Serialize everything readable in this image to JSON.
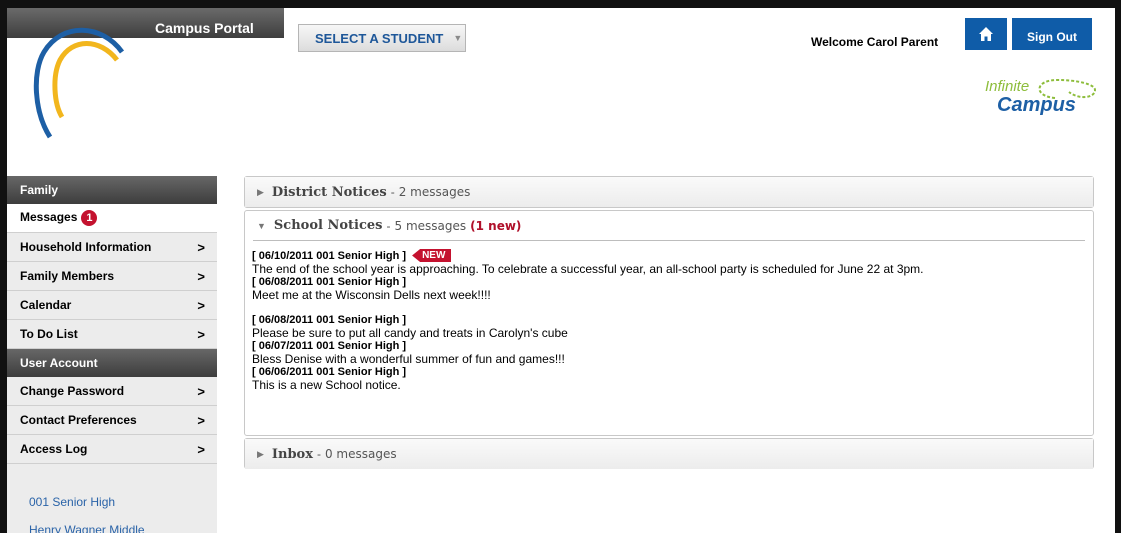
{
  "header": {
    "portal_title": "Campus Portal",
    "select_student_label": "SELECT A STUDENT",
    "welcome_text": "Welcome Carol Parent",
    "home_icon": "home-icon",
    "sign_out_label": "Sign Out",
    "logo_line1": "Infinite",
    "logo_line2": "Campus"
  },
  "sidebar": {
    "sections": [
      {
        "title": "Family",
        "items": [
          {
            "label": "Messages",
            "badge": "1"
          },
          {
            "label": "Household Information",
            "chevron": ">"
          },
          {
            "label": "Family Members",
            "chevron": ">"
          },
          {
            "label": "Calendar",
            "chevron": ">"
          },
          {
            "label": "To Do List",
            "chevron": ">"
          }
        ]
      },
      {
        "title": "User Account",
        "items": [
          {
            "label": "Change Password",
            "chevron": ">"
          },
          {
            "label": "Contact Preferences",
            "chevron": ">"
          },
          {
            "label": "Access Log",
            "chevron": ">"
          }
        ]
      }
    ],
    "schools": [
      "001 Senior High",
      "Henry Wagner Middle"
    ]
  },
  "panels": {
    "district": {
      "title": "District Notices",
      "sep": "-",
      "count": "2 messages"
    },
    "school": {
      "title": "School Notices",
      "sep": "-",
      "count": "5 messages",
      "new_count": "(1 new)",
      "new_tag": "NEW",
      "messages": [
        {
          "header": "[ 06/10/2011 001 Senior High ]",
          "text": "The end of the school year is approaching. To celebrate a successful year, an all-school party is scheduled for June 22 at 3pm."
        },
        {
          "header": "[ 06/08/2011 001 Senior High ]",
          "text": "Meet me at the Wisconsin Dells next week!!!!"
        },
        {
          "header": "[ 06/08/2011 001 Senior High ]",
          "text": "Please be sure to put all candy and treats in Carolyn's cube"
        },
        {
          "header": "[ 06/07/2011 001 Senior High ]",
          "text": "Bless Denise with a wonderful summer of fun and games!!!"
        },
        {
          "header": "[ 06/06/2011 001 Senior High ]",
          "text": "This is a new School notice."
        }
      ]
    },
    "inbox": {
      "title": "Inbox",
      "sep": "-",
      "count": "0 messages"
    }
  },
  "colors": {
    "brand_blue": "#0f5ca8",
    "alert_red": "#c4122f",
    "header_gray": "#3e3e3e"
  }
}
